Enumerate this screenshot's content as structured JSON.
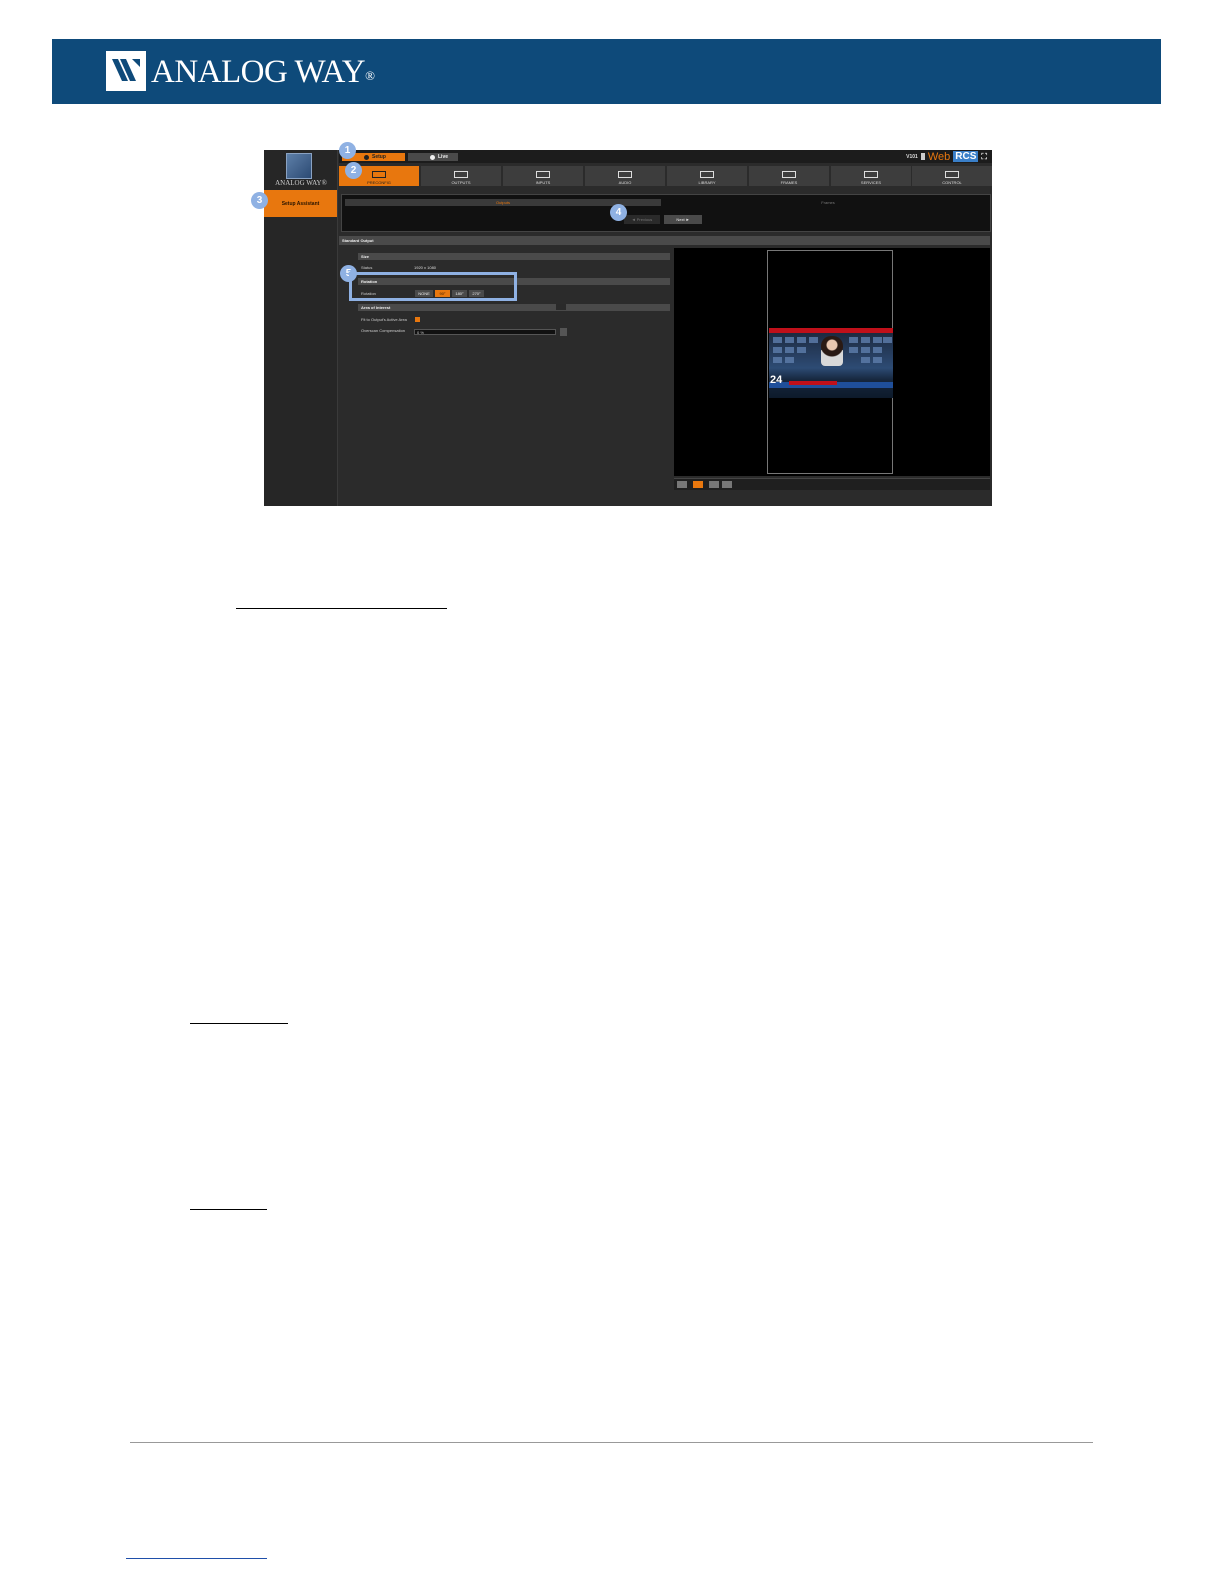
{
  "header": {
    "brand": "ANALOG WAY",
    "registered": "®",
    "bg_color": "#0e4a7a"
  },
  "app": {
    "logo_text": "ANALOG WAY",
    "logo_sup": "®",
    "mode_tabs": [
      {
        "label": "Setup",
        "active": true
      },
      {
        "label": "Live",
        "active": false
      }
    ],
    "device": "V101",
    "webrcs": {
      "web": "Web",
      "rcs": "RCS"
    },
    "menu": [
      {
        "label": "PRECONFIG",
        "active": true
      },
      {
        "label": "OUTPUTS",
        "active": false
      },
      {
        "label": "INPUTS",
        "active": false
      },
      {
        "label": "AUDIO",
        "active": false
      },
      {
        "label": "LIBRARY",
        "active": false
      },
      {
        "label": "FRAMES",
        "active": false
      },
      {
        "label": "SERVICES",
        "active": false
      },
      {
        "label": "CONTROL",
        "active": false
      }
    ],
    "sidebar": {
      "item": "Setup Assistant"
    },
    "wizard": {
      "step_outputs": "Outputs",
      "step_frames": "Frames",
      "previous": "◄ Previous",
      "next": "Next ►"
    },
    "section_title": "Standard Output",
    "size_header": "Size",
    "status_label": "Status",
    "status_value": "1920 x 1080",
    "rotation_header": "Rotation",
    "rotation_label": "Rotation",
    "rotation_options": [
      "NONE",
      "90°",
      "180°",
      "270°"
    ],
    "rotation_selected": "90°",
    "aoi_header": "Area of Interest",
    "fit_label": "Fit to Output's Active Area",
    "overscan_label": "Overscan Compensation",
    "overscan_value": "0 %",
    "news_number": "24",
    "accent": "#e8770e"
  },
  "callouts": [
    "1",
    "2",
    "3",
    "4",
    "5"
  ],
  "callout_color": "#8fb1e3"
}
